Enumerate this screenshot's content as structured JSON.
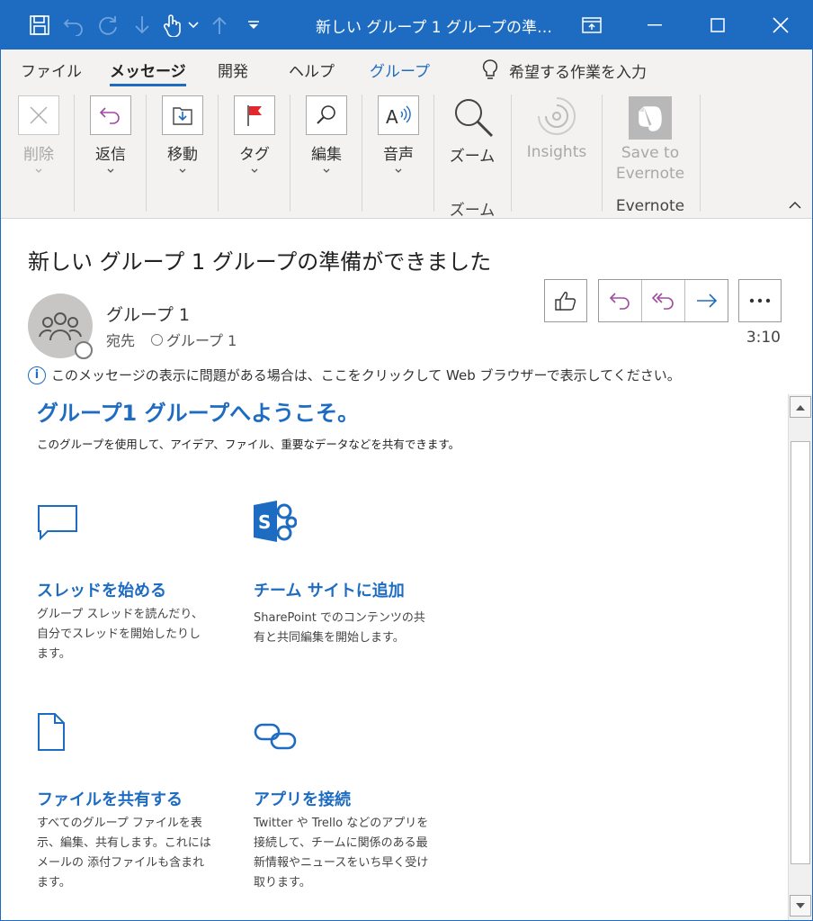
{
  "window": {
    "title": "新しい グループ 1 グループの準…"
  },
  "ribbon_tabs": {
    "file": "ファイル",
    "message": "メッセージ",
    "develop": "開発",
    "help": "ヘルプ",
    "group": "グループ",
    "tell_me": "希望する作業を入力"
  },
  "ribbon": {
    "delete": "削除",
    "reply": "返信",
    "move": "移動",
    "tags": "タグ",
    "edit": "編集",
    "voice": "音声",
    "zoom": "ズーム",
    "zoom_group": "ズーム",
    "insights": "Insights",
    "evernote_line1": "Save to",
    "evernote_line2": "Evernote",
    "evernote_group": "Evernote"
  },
  "message": {
    "subject": "新しい グループ 1  グループの準備ができました",
    "sender": "グループ 1",
    "to_label": "宛先",
    "to_value": "グループ 1",
    "time": "3:10",
    "info": "このメッセージの表示に問題がある場合は、ここをクリックして Web ブラウザーで表示してください。"
  },
  "body": {
    "welcome": "グループ1 グループへようこそ。",
    "intro": "このグループを使用して、アイデア、ファイル、重要なデータなどを共有できます。",
    "features": [
      {
        "title": "スレッドを始める",
        "desc": "グループ スレッドを読んだり、自分でスレッドを開始したりします。"
      },
      {
        "title": "チーム サイトに追加",
        "desc": "SharePoint でのコンテンツの共有と共同編集を開始します。"
      },
      {
        "title": "ファイルを共有する",
        "desc": "すべてのグループ ファイルを表示、編集、共有します。これにはメールの 添付ファイルも含まれます。"
      },
      {
        "title": "アプリを接続",
        "desc": "Twitter や Trello などのアプリを接続して、チームに関係のある最新情報やニュースをいち早く受け取ります。"
      }
    ]
  },
  "colors": {
    "titlebar": "#1e6cc2",
    "accent": "#1e6cc2",
    "reply_icon": "#a04aa0",
    "forward_icon": "#1e6cc2"
  },
  "icons": [
    "save-icon",
    "undo-icon",
    "redo-icon",
    "down-arrow-icon",
    "touch-icon",
    "up-arrow-icon",
    "customize-icon",
    "restore-icon",
    "minimize-icon",
    "maximize-icon",
    "close-icon",
    "delete-icon",
    "reply-icon",
    "move-icon",
    "flag-icon",
    "find-icon",
    "read-aloud-icon",
    "zoom-icon",
    "insights-icon",
    "evernote-icon",
    "like-icon",
    "reply-all-icon",
    "forward-icon",
    "more-icon",
    "info-icon",
    "chat-icon",
    "sharepoint-icon",
    "file-icon",
    "link-icon"
  ]
}
